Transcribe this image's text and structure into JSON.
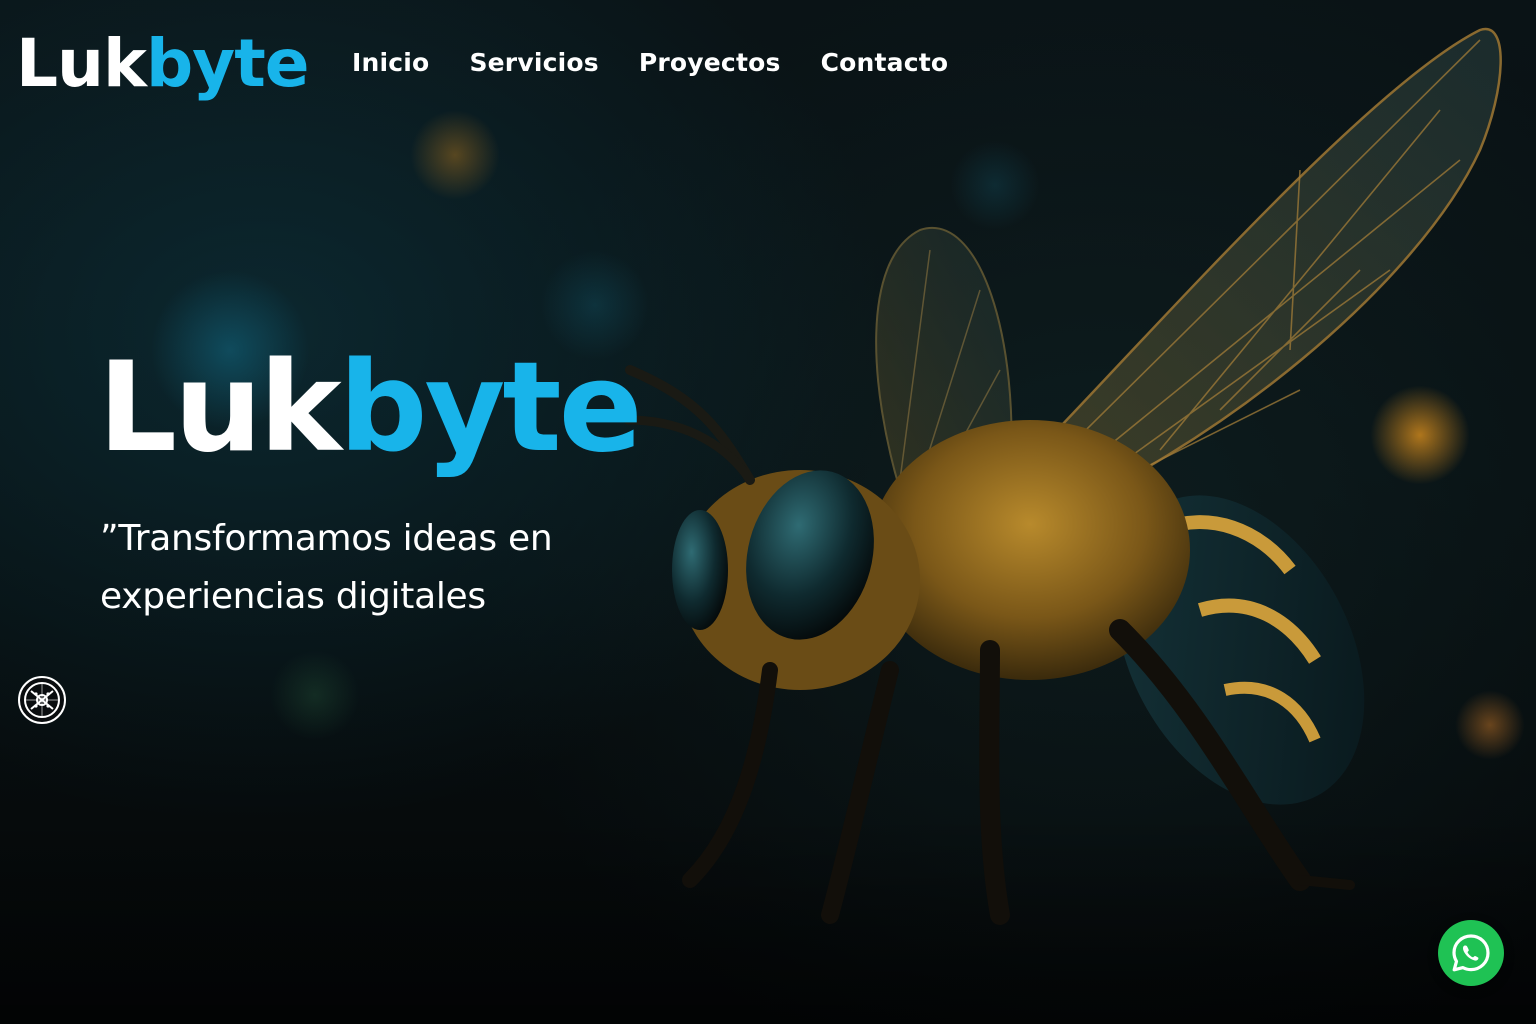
{
  "brand": {
    "name_part1": "Luk",
    "name_part2": "byte",
    "accent_color": "#18b4ea"
  },
  "nav": {
    "items": [
      {
        "label": "Inicio"
      },
      {
        "label": "Servicios"
      },
      {
        "label": "Proyectos"
      },
      {
        "label": "Contacto"
      }
    ]
  },
  "hero": {
    "title_part1": "Luk",
    "title_part2": "byte",
    "tagline": "”Transformamos ideas en experiencias digitales"
  },
  "widgets": {
    "accessibility_icon": "accessibility-icon",
    "whatsapp_icon": "whatsapp-icon",
    "whatsapp_color": "#1fc254"
  },
  "illustration": {
    "subject": "bee-icon"
  }
}
